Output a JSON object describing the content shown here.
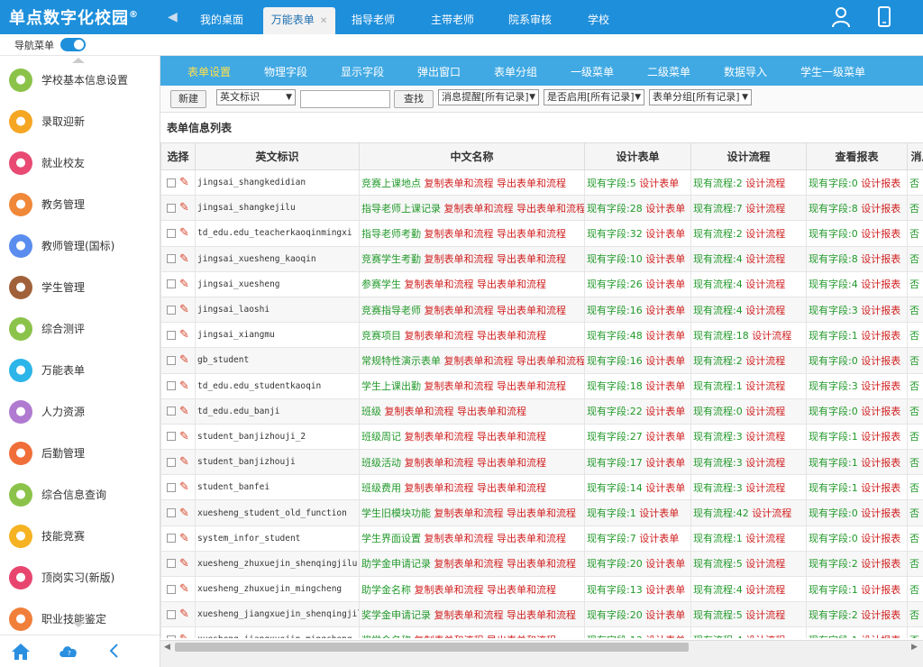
{
  "app": {
    "title": "单点数字化校园",
    "reg": "®"
  },
  "top_tabs": [
    {
      "label": "我的桌面",
      "active": false
    },
    {
      "label": "万能表单",
      "active": true,
      "closable": true
    },
    {
      "label": "指导老师",
      "active": false
    },
    {
      "label": "主带老师",
      "active": false
    },
    {
      "label": "院系审核",
      "active": false
    },
    {
      "label": "学校",
      "active": false
    }
  ],
  "nav_toggle": {
    "label": "导航菜单",
    "on": true
  },
  "sidebar": {
    "items": [
      {
        "label": "学校基本信息设置",
        "color": "#8bc34a"
      },
      {
        "label": "录取迎新",
        "color": "#f5a623"
      },
      {
        "label": "就业校友",
        "color": "#e84a73"
      },
      {
        "label": "教务管理",
        "color": "#f0883a"
      },
      {
        "label": "教师管理(国标)",
        "color": "#5b8def"
      },
      {
        "label": "学生管理",
        "color": "#a0613a"
      },
      {
        "label": "综合测评",
        "color": "#8bc34a"
      },
      {
        "label": "万能表单",
        "color": "#2bb5e8"
      },
      {
        "label": "人力资源",
        "color": "#b07ad0"
      },
      {
        "label": "后勤管理",
        "color": "#f06e3a"
      },
      {
        "label": "综合信息查询",
        "color": "#8bc34a"
      },
      {
        "label": "技能竞赛",
        "color": "#f5b323"
      },
      {
        "label": "顶岗实习(新版)",
        "color": "#e8456e"
      },
      {
        "label": "职业技能鉴定",
        "color": "#f07f3a"
      }
    ]
  },
  "subtabs": [
    {
      "label": "表单设置",
      "active": true
    },
    {
      "label": "物理字段",
      "active": false
    },
    {
      "label": "显示字段",
      "active": false
    },
    {
      "label": "弹出窗口",
      "active": false
    },
    {
      "label": "表单分组",
      "active": false
    },
    {
      "label": "一级菜单",
      "active": false
    },
    {
      "label": "二级菜单",
      "active": false
    },
    {
      "label": "数据导入",
      "active": false
    },
    {
      "label": "学生一级菜单",
      "active": false
    }
  ],
  "toolbar": {
    "new_label": "新建",
    "field_select": "英文标识",
    "search_value": "",
    "search_label": "查找",
    "filter1": "消息提醒[所有记录]",
    "filter2": "是否启用[所有记录]",
    "filter3": "表单分组[所有记录]"
  },
  "list_title": "表单信息列表",
  "columns": [
    "选择",
    "英文标识",
    "中文名称",
    "设计表单",
    "设计流程",
    "查看报表",
    "消息"
  ],
  "link_labels": {
    "copy": "复制表单和流程",
    "export": "导出表单和流程",
    "fields_prefix": "现有字段:",
    "design_form": "设计表单",
    "flows_prefix": "现有流程:",
    "design_flow": "设计流程",
    "report_prefix": "现有字段:",
    "design_report": "设计报表"
  },
  "rows": [
    {
      "en": "jingsai_shangkedidian",
      "cn": "竞赛上课地点",
      "fields": "5",
      "flows": "2",
      "reports": "0",
      "msg": "否"
    },
    {
      "en": "jingsai_shangkejilu",
      "cn": "指导老师上课记录",
      "fields": "28",
      "flows": "7",
      "reports": "8",
      "msg": "否"
    },
    {
      "en": "td_edu.edu_teacherkaoqinmingxi",
      "cn": "指导老师考勤",
      "fields": "32",
      "flows": "2",
      "reports": "0",
      "msg": "否"
    },
    {
      "en": "jingsai_xuesheng_kaoqin",
      "cn": "竞赛学生考勤",
      "fields": "10",
      "flows": "4",
      "reports": "8",
      "msg": "否"
    },
    {
      "en": "jingsai_xuesheng",
      "cn": "参赛学生",
      "fields": "26",
      "flows": "4",
      "reports": "4",
      "msg": "否"
    },
    {
      "en": "jingsai_laoshi",
      "cn": "竞赛指导老师",
      "fields": "16",
      "flows": "4",
      "reports": "3",
      "msg": "否"
    },
    {
      "en": "jingsai_xiangmu",
      "cn": "竞赛项目",
      "fields": "48",
      "flows": "18",
      "reports": "1",
      "msg": "否"
    },
    {
      "en": "gb_student",
      "cn": "常规特性演示表单",
      "fields": "16",
      "flows": "2",
      "reports": "0",
      "msg": "否"
    },
    {
      "en": "td_edu.edu_studentkaoqin",
      "cn": "学生上课出勤",
      "fields": "18",
      "flows": "1",
      "reports": "3",
      "msg": "否"
    },
    {
      "en": "td_edu.edu_banji",
      "cn": "班级",
      "fields": "22",
      "flows": "0",
      "reports": "0",
      "msg": "否"
    },
    {
      "en": "student_banjizhouji_2",
      "cn": "班级周记",
      "fields": "27",
      "flows": "3",
      "reports": "1",
      "msg": "否"
    },
    {
      "en": "student_banjizhouji",
      "cn": "班级活动",
      "fields": "17",
      "flows": "3",
      "reports": "1",
      "msg": "否"
    },
    {
      "en": "student_banfei",
      "cn": "班级费用",
      "fields": "14",
      "flows": "3",
      "reports": "1",
      "msg": "否"
    },
    {
      "en": "xuesheng_student_old_function",
      "cn": "学生旧模块功能",
      "fields": "1",
      "flows": "42",
      "reports": "0",
      "msg": "否"
    },
    {
      "en": "system_infor_student",
      "cn": "学生界面设置",
      "fields": "7",
      "flows": "1",
      "reports": "0",
      "msg": "否"
    },
    {
      "en": "xuesheng_zhuxuejin_shenqingjilu",
      "cn": "助学金申请记录",
      "fields": "20",
      "flows": "5",
      "reports": "2",
      "msg": "否"
    },
    {
      "en": "xuesheng_zhuxuejin_mingcheng",
      "cn": "助学金名称",
      "fields": "13",
      "flows": "4",
      "reports": "1",
      "msg": "否"
    },
    {
      "en": "xuesheng_jiangxuejin_shenqingjilu",
      "cn": "奖学金申请记录",
      "fields": "20",
      "flows": "5",
      "reports": "2",
      "msg": "否"
    },
    {
      "en": "xuesheng_jiangxuejin_mingcheng",
      "cn": "奖学金名称",
      "fields": "13",
      "flows": "4",
      "reports": "1",
      "msg": "否"
    }
  ]
}
